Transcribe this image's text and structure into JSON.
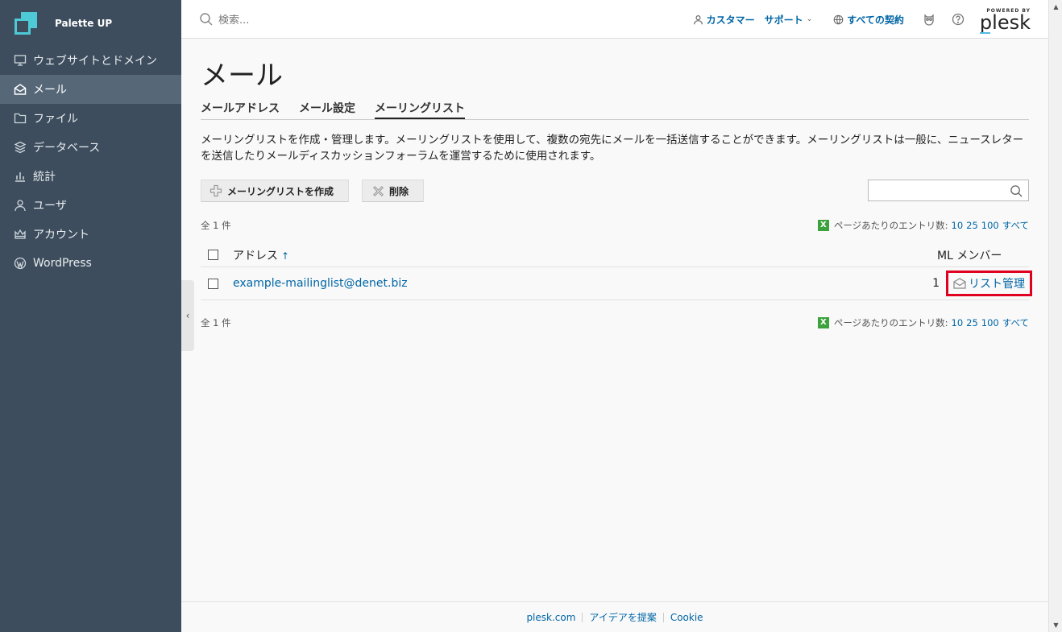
{
  "brand": {
    "name": "Palette UP"
  },
  "sidebar": {
    "items": [
      {
        "label": "ウェブサイトとドメイン",
        "icon": "monitor-icon"
      },
      {
        "label": "メール",
        "icon": "mail-icon",
        "active": true
      },
      {
        "label": "ファイル",
        "icon": "folder-icon"
      },
      {
        "label": "データベース",
        "icon": "database-icon"
      },
      {
        "label": "統計",
        "icon": "bar-chart-icon"
      },
      {
        "label": "ユーザ",
        "icon": "user-icon"
      },
      {
        "label": "アカウント",
        "icon": "crown-icon"
      },
      {
        "label": "WordPress",
        "icon": "wordpress-icon"
      }
    ],
    "collapse_glyph": "‹"
  },
  "header": {
    "search_placeholder": "検索...",
    "customer": "カスタマー",
    "support": "サポート",
    "subscriptions": "すべての契約",
    "powered_by": "POWERED BY",
    "plesk": "plesk"
  },
  "page": {
    "title": "メール",
    "tabs": [
      {
        "label": "メールアドレス"
      },
      {
        "label": "メール設定"
      },
      {
        "label": "メーリングリスト",
        "active": true
      }
    ],
    "description": "メーリングリストを作成・管理します。メーリングリストを使用して、複数の宛先にメールを一括送信することができます。メーリングリストは一般に、ニュースレターを送信したりメールディスカッションフォーラムを運営するために使用されます。",
    "toolbar": {
      "create_label": "メーリングリストを作成",
      "delete_label": "削除"
    }
  },
  "list": {
    "total": "全 1 件",
    "per_page_label": "ページあたりのエントリ数:",
    "per_page_options": [
      "10",
      "25",
      "100",
      "すべて"
    ],
    "columns": {
      "address": "アドレス",
      "members": "ML メンバー"
    },
    "sort_glyph": "↑",
    "rows": [
      {
        "address": "example-mailinglist@denet.biz",
        "members": "1",
        "action": "リスト管理"
      }
    ]
  },
  "footer": {
    "links": [
      "plesk.com",
      "アイデアを提案",
      "Cookie"
    ]
  },
  "colors": {
    "sidebar_bg": "#3d4d5d",
    "link": "#0066a6",
    "highlight": "#e00020",
    "brand_accent": "#4ec9d6"
  }
}
